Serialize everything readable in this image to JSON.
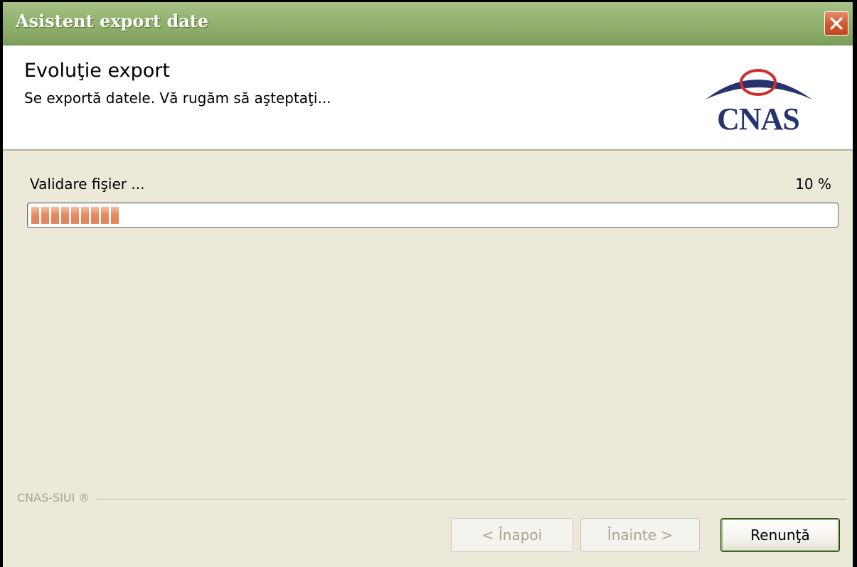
{
  "window": {
    "title": "Asistent export date"
  },
  "header": {
    "title": "Evoluţie export",
    "subtitle": "Se exportă datele. Vă rugăm să aşteptaţi...",
    "logo_text": "CNAS"
  },
  "progress": {
    "status_text": "Validare fişier ...",
    "percent_label": "10 %",
    "value_fraction": 0.115,
    "fill_color": "#e88b5f"
  },
  "footer": {
    "brand_label": "CNAS-SIUI ®"
  },
  "buttons": {
    "back_label": "< Înapoi",
    "next_label": "Înainte >",
    "cancel_label": "Renunţă"
  },
  "icons": {
    "close": "close-icon",
    "logo": "cnas-logo"
  },
  "colors": {
    "titlebar": "#8aab66",
    "close_button": "#d45a33",
    "window_bg": "#ece9d8",
    "logo_blue": "#25346f",
    "logo_red": "#d32b2b"
  }
}
